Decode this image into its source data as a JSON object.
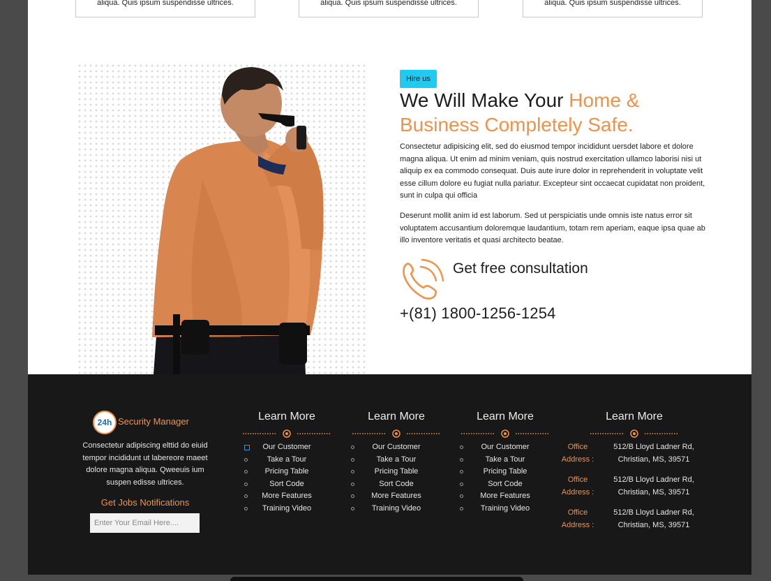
{
  "top_cards": [
    {
      "text": "aliqua. Quis ipsum suspendisse ultrices."
    },
    {
      "text": "aliqua. Quis ipsum suspendisse ultrices."
    },
    {
      "text": "aliqua. Quis ipsum suspendisse ultrices."
    }
  ],
  "hero": {
    "badge": "Hire us",
    "headline_plain": "We Will Make Your ",
    "headline_accent": "Home & Business Completely Safe.",
    "paragraph1": "Consectetur adipisicing elit, sed do eiusmod tempor incididunt uersdet labore et dolore magna aliqua. Ut enim ad minim veniam, quis nostrud exercitation ullamco laborisi nisi ut aliquip ex ea commodo consequat. Duis aute irure dolor in reprehenderit in voluptate velit esse cillum dolore eu fugiat nulla pariatur. Excepteur sint occaecat cupidatat non proident, sunt in culpa qui officia",
    "paragraph2": "Deserunt mollit anim id est laborum. Sed ut perspiciatis unde omnis iste natus error sit voluptatem accusantium doloremque laudantium, totam rem aperiam, eaque ipsa quae ab illo inventore veritatis et quasi architecto beatae.",
    "consult_label": "Get free consultation",
    "phone": "+(81) 1800-1256-1254",
    "phone_icon": "phone-icon",
    "accent_color": "#f0924a"
  },
  "footer": {
    "brand_badge": "24h",
    "brand_name": "Security Manager",
    "about": "Consectetur adipiscing elttid do eiuid tempor incididunt ut labereore maeet dolore magna aliqua. Qweeuis ium suspen edisse ultrices.",
    "jobs_title": "Get Jobs Notifications",
    "email_placeholder": "Enter Your Email Here....",
    "columns": [
      {
        "title": "Learn More",
        "items": [
          "Our Customer",
          "Take a Tour",
          "Pricing Table",
          "Sort Code",
          "More Features",
          "Training Video"
        ]
      },
      {
        "title": "Learn More",
        "items": [
          "Our Customer",
          "Take a Tour",
          "Pricing Table",
          "Sort Code",
          "More Features",
          "Training Video"
        ]
      },
      {
        "title": "Learn More",
        "items": [
          "Our Customer",
          "Take a Tour",
          "Pricing Table",
          "Sort Code",
          "More Features",
          "Training Video"
        ]
      }
    ],
    "address_column": {
      "title": "Learn More",
      "entries": [
        {
          "label_line1": "Office",
          "label_line2": "Address :",
          "value_line1": "512/B Lloyd Ladner Rd,",
          "value_line2": "Christian, MS, 39571"
        },
        {
          "label_line1": "Office",
          "label_line2": "Address :",
          "value_line1": "512/B Lloyd Ladner Rd,",
          "value_line2": "Christian, MS, 39571"
        },
        {
          "label_line1": "Office",
          "label_line2": "Address :",
          "value_line1": "512/B Lloyd Ladner Rd,",
          "value_line2": "Christian, MS, 39571"
        }
      ]
    },
    "background_color": "#181818"
  }
}
